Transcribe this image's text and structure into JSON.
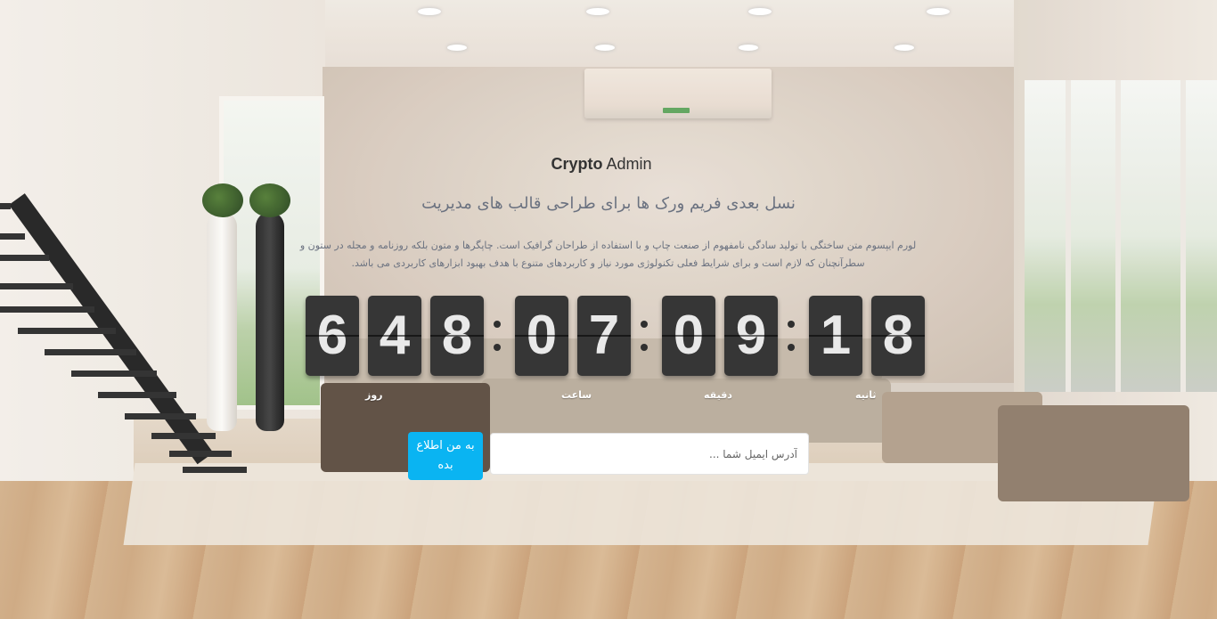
{
  "header": {
    "brand_bold": "Crypto",
    "brand_light": " Admin"
  },
  "hero": {
    "subtitle": "نسل بعدی فریم ورک ها برای طراحی قالب های مدیریت",
    "description": "لورم ایپسوم متن ساختگی با تولید سادگی نامفهوم از صنعت چاپ و با استفاده از طراحان گرافیک است. چاپگرها و متون بلکه روزنامه و مجله در ستون و سطرآنچنان که لازم است و برای شرایط فعلی تکنولوژی مورد نیاز و کاربردهای متنوع با هدف بهبود ابزارهای کاربردی می باشد."
  },
  "countdown": {
    "days_digits": [
      "6",
      "4",
      "8"
    ],
    "hours_digits": [
      "0",
      "7"
    ],
    "minutes_digits": [
      "0",
      "9"
    ],
    "seconds_digits": [
      "1",
      "8"
    ],
    "labels": {
      "days": "روز",
      "hours": "ساعت",
      "minutes": "دقیقه",
      "seconds": "ثانیه"
    }
  },
  "subscribe": {
    "button_label": "به من اطلاع بده",
    "email_placeholder": "آدرس ایمیل شما ..."
  },
  "colors": {
    "accent": "#0ab4f2",
    "digit_bg": "#363636",
    "digit_text": "#e9e9e9"
  }
}
